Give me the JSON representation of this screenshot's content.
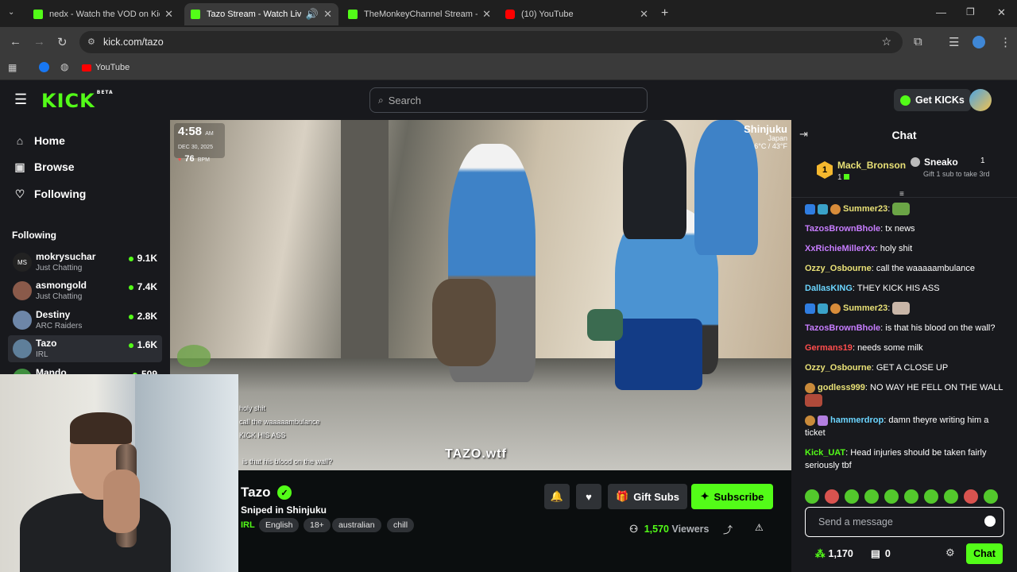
{
  "browser": {
    "tabs": [
      {
        "title": "nedx - Watch the VOD on Kick"
      },
      {
        "title": "Tazo Stream - Watch Live on Kick"
      },
      {
        "title": "TheMonkeyChannel Stream - Watch"
      },
      {
        "title": "(10) YouTube"
      }
    ],
    "url": "kick.com/tazo",
    "bookmark": "YouTube"
  },
  "header": {
    "logo": "KICK",
    "beta": "BETA",
    "search_placeholder": "Search",
    "get_kicks": "Get KICKs"
  },
  "sidebar": {
    "nav": [
      {
        "label": "Home"
      },
      {
        "label": "Browse"
      },
      {
        "label": "Following"
      }
    ],
    "following_heading": "Following",
    "channels": [
      {
        "name": "mokrysuchar",
        "category": "Just Chatting",
        "viewers": "9.1K",
        "initials": "MS"
      },
      {
        "name": "asmongold",
        "category": "Just Chatting",
        "viewers": "7.4K"
      },
      {
        "name": "Destiny",
        "category": "ARC Raiders",
        "viewers": "2.8K"
      },
      {
        "name": "Tazo",
        "category": "IRL",
        "viewers": "1.6K"
      },
      {
        "name": "Mando",
        "viewers": "509"
      }
    ]
  },
  "video": {
    "time": "4:58",
    "ampm": "AM",
    "date": "DEC 30, 2025",
    "bpm": "76",
    "bpm_unit": "BPM",
    "location": "Shinjuku",
    "country": "Japan",
    "temperature": "6°C / 43°F",
    "watermark": "TAZO.wtf",
    "overlay_lines": [
      "holy shit",
      "call the waaaaambulance",
      "KICK HIS ASS",
      "is that his blood on the wall?"
    ]
  },
  "stream": {
    "streamer": "Tazo",
    "title": "Sniped in Shinjuku",
    "category": "IRL",
    "tags": [
      "English",
      "18+",
      "australian",
      "chill"
    ],
    "gift_subs_label": "Gift Subs",
    "subscribe_label": "Subscribe",
    "viewers": "1,570",
    "viewers_label": "Viewers"
  },
  "chat": {
    "title": "Chat",
    "top_gifter": {
      "rank": "1",
      "name": "Mack_Bronson",
      "count": "1"
    },
    "second_gifter": {
      "name": "Sneako",
      "count": "1",
      "note": "Gift 1 sub to take 3rd"
    },
    "messages": [
      {
        "user": "Summer23",
        "text": "",
        "color": "#e8e076"
      },
      {
        "user": "TazosBrownBhole",
        "text": "tx news",
        "color": "#c77dff"
      },
      {
        "user": "XxRichieMillerXx",
        "text": "holy shit",
        "color": "#c77dff"
      },
      {
        "user": "Ozzy_Osbourne",
        "text": "call the waaaaambulance",
        "color": "#e8e076"
      },
      {
        "user": "DallasKING",
        "text": "THEY KICK HIS ASS",
        "color": "#6bd5ff"
      },
      {
        "user": "Summer23",
        "text": "",
        "color": "#e8e076"
      },
      {
        "user": "TazosBrownBhole",
        "text": "is that his blood on the wall?",
        "color": "#c77dff"
      },
      {
        "user": "Germans19",
        "text": "needs some milk",
        "color": "#ff4d4d"
      },
      {
        "user": "Ozzy_Osbourne",
        "text": "GET A CLOSE UP",
        "color": "#e8e076"
      },
      {
        "user": "godless999",
        "text": "NO WAY HE FELL ON THE WALL",
        "color": "#e8e076"
      },
      {
        "user": "hammerdrop",
        "text": "damn theyre writing him a ticket",
        "color": "#6bd5ff"
      },
      {
        "user": "Kick_UAT",
        "text": "Head injuries should be taken fairly seriously tbf",
        "color": "#53fc18"
      }
    ],
    "input_placeholder": "Send a message",
    "points": "1,170",
    "count_zero": "0",
    "send_label": "Chat"
  }
}
